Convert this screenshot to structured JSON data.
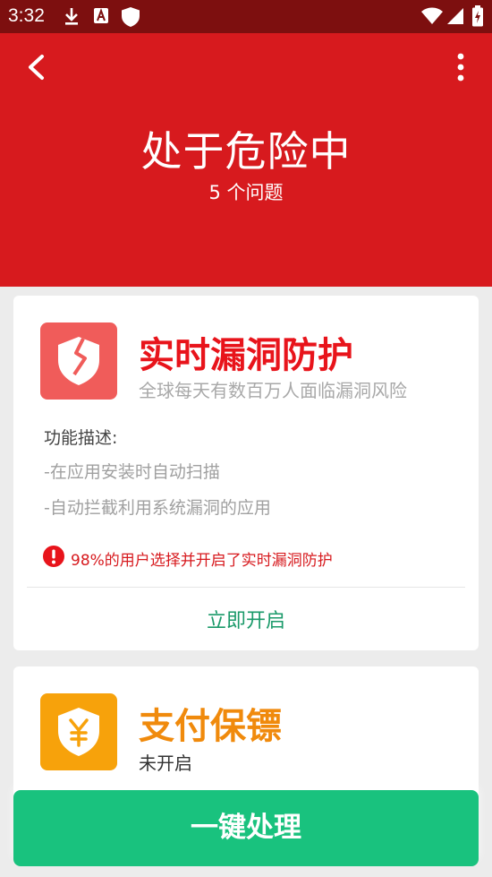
{
  "status_bar": {
    "time": "3:32",
    "left_icons": [
      "download-icon",
      "a-badge-icon",
      "shield-icon"
    ],
    "right_icons": [
      "wifi-icon",
      "signal-icon",
      "battery-charging-icon"
    ]
  },
  "header": {
    "title": "处于危险中",
    "subtitle": "5 个问题",
    "back_icon": "chevron-left-icon",
    "menu_icon": "more-vert-icon",
    "background": "#d71a1e"
  },
  "cards": [
    {
      "icon": "broken-shield-icon",
      "icon_color": "#f05c5a",
      "title": "实时漏洞防护",
      "title_color": "#e8141b",
      "subtitle": "全球每天有数百万人面临漏洞风险",
      "desc_heading": "功能描述:",
      "desc_items": [
        "-在应用安装时自动扫描",
        "-自动拦截利用系统漏洞的应用"
      ],
      "warning_icon": "alert-circle-icon",
      "warning_text": "98%的用户选择并开启了实时漏洞防护",
      "action_label": "立即开启"
    },
    {
      "icon": "yen-shield-icon",
      "icon_color": "#f7a20b",
      "title": "支付保镖",
      "title_color": "#f08a0c",
      "subtitle": "未开启"
    }
  ],
  "bottom_button": {
    "label": "一键处理",
    "color": "#19c27e"
  }
}
